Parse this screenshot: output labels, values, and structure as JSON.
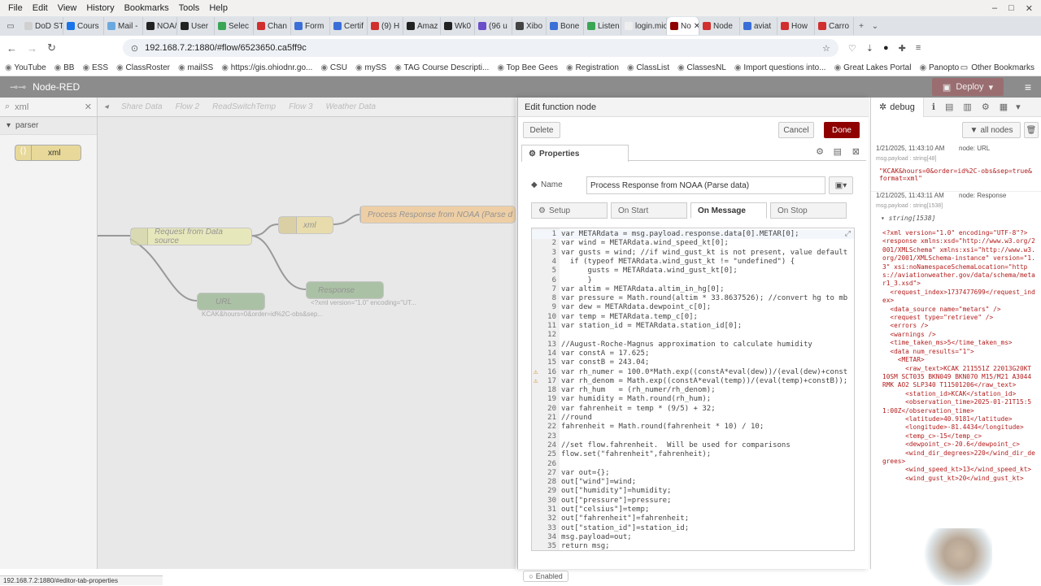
{
  "browser": {
    "menu": [
      "File",
      "Edit",
      "View",
      "History",
      "Bookmarks",
      "Tools",
      "Help"
    ],
    "tabs": [
      {
        "label": "DoD STE",
        "color": "#d0d0d0"
      },
      {
        "label": "Cours",
        "color": "#1a73e8"
      },
      {
        "label": "Mail -",
        "color": "#6aa9e0"
      },
      {
        "label": "NOA/",
        "color": "#222222"
      },
      {
        "label": "User",
        "color": "#222222"
      },
      {
        "label": "Selec",
        "color": "#3aa655"
      },
      {
        "label": "Chan",
        "color": "#d12e2e"
      },
      {
        "label": "Form",
        "color": "#3a6fd8"
      },
      {
        "label": "Certif",
        "color": "#3a6fd8"
      },
      {
        "label": "(9) H",
        "color": "#d12e2e"
      },
      {
        "label": "Amaz",
        "color": "#222222"
      },
      {
        "label": "Wk0",
        "color": "#222222"
      },
      {
        "label": "(96 u",
        "color": "#6b4fc9"
      },
      {
        "label": "Xibo",
        "color": "#444444"
      },
      {
        "label": "Bone",
        "color": "#3a6fd8"
      },
      {
        "label": "Listen",
        "color": "#3aa655"
      },
      {
        "label": "login.mic",
        "color": "#eeeeee"
      },
      {
        "label": "No",
        "color": "#8f0000"
      },
      {
        "label": "Node",
        "color": "#d12e2e"
      },
      {
        "label": "aviat",
        "color": "#3a6fd8"
      },
      {
        "label": "How",
        "color": "#d12e2e"
      },
      {
        "label": "Carro",
        "color": "#d12e2e"
      }
    ],
    "url": "192.168.7.2:1880/#flow/6523650.ca5ff9c",
    "bookmarks": [
      "YouTube",
      "BB",
      "ESS",
      "ClassRoster",
      "mailSS",
      "https://gis.ohiodnr.go...",
      "CSU",
      "mySS",
      "TAG Course Descripti...",
      "Top Bee Gees",
      "Registration",
      "ClassList",
      "ClassesNL",
      "Import questions into...",
      "Great Lakes Portal",
      "Panopto"
    ],
    "other_bookmarks": "Other Bookmarks",
    "status_url": "192.168.7.2:1880/#editor-tab-properties"
  },
  "nodered": {
    "title": "Node-RED",
    "deploy": "Deploy",
    "palette": {
      "search": "xml",
      "category": "parser",
      "node": "xml"
    },
    "workspace_tabs": [
      "Share Data",
      "Flow 2",
      "ReadSwitchTemp",
      "Flow 3",
      "Weather Data"
    ],
    "nodes": {
      "request": "Request from Data source",
      "xml": "xml",
      "process": "Process Response from NOAA (Parse d",
      "response": "Response",
      "response_status": "<?xml version=\"1.0\" encoding=\"UT...",
      "url": "URL",
      "url_status": "KCAK&hours=0&order=id%2C-obs&sep..."
    }
  },
  "editor": {
    "title": "Edit function node",
    "delete": "Delete",
    "cancel": "Cancel",
    "done": "Done",
    "properties": "Properties",
    "name_label": "Name",
    "name_value": "Process Response from NOAA (Parse data)",
    "tabs": [
      "Setup",
      "On Start",
      "On Message",
      "On Stop"
    ],
    "enabled": "Enabled",
    "code": [
      "var METARdata = msg.payload.response.data[0].METAR[0];",
      "var wind = METARdata.wind_speed_kt[0];",
      "var gusts = wind; //if wind_gust_kt is not present, value default",
      "  if (typeof METARdata.wind_gust_kt != \"undefined\") {",
      "      gusts = METARdata.wind_gust_kt[0];",
      "      }",
      "var altim = METARdata.altim_in_hg[0];",
      "var pressure = Math.round(altim * 33.8637526); //convert hg to mb",
      "var dew = METARdata.dewpoint_c[0];",
      "var temp = METARdata.temp_c[0];",
      "var station_id = METARdata.station_id[0];",
      "",
      "//August-Roche-Magnus approximation to calculate humidity",
      "var constA = 17.625;",
      "var constB = 243.04;",
      "var rh_numer = 100.0*Math.exp((constA*eval(dew))/(eval(dew)+const",
      "var rh_denom = Math.exp((constA*eval(temp))/(eval(temp)+constB));",
      "var rh_hum   = (rh_numer/rh_denom);",
      "var humidity = Math.round(rh_hum);",
      "var fahrenheit = temp * (9/5) + 32;",
      "//round",
      "fahrenheit = Math.round(fahrenheit * 10) / 10;",
      "",
      "//set flow.fahrenheit.  Will be used for comparisons",
      "flow.set(\"fahrenheit\",fahrenheit);",
      "",
      "var out={};",
      "out[\"wind\"]=wind;",
      "out[\"humidity\"]=humidity;",
      "out[\"pressure\"]=pressure;",
      "out[\"celsius\"]=temp;",
      "out[\"fahrenheit\"]=fahrenheit;",
      "out[\"station_id\"]=station_id;",
      "msg.payload=out;",
      "return msg;"
    ]
  },
  "debug": {
    "tab": "debug",
    "filter": "all nodes",
    "msg1_time": "1/21/2025, 11:43:10 AM",
    "msg1_node": "node: URL",
    "msg1_type": "msg.payload : string[48]",
    "msg1_value": "\"KCAK&hours=0&order=id%2C-obs&sep=true&format=xml\"",
    "msg2_time": "1/21/2025, 11:43:11 AM",
    "msg2_node": "node: Response",
    "msg2_type": "msg.payload : string[1538]",
    "msg2_summary": "string[1538]",
    "xml": "<?xml version=\"1.0\" encoding=\"UTF-8\"?>\n<response xmlns:xsd=\"http://www.w3.org/2001/XMLSchema\" xmlns:xsi=\"http://www.w3.org/2001/XMLSchema-instance\" version=\"1.3\" xsi:noNamespaceSchemaLocation=\"https://aviationweather.gov/data/schema/metar1_3.xsd\">\n  <request_index>1737477699</request_index>\n  <data_source name=\"metars\" />\n  <request type=\"retrieve\" />\n  <errors />\n  <warnings />\n  <time_taken_ms>5</time_taken_ms>\n  <data num_results=\"1\">\n    <METAR>\n      <raw_text>KCAK 211551Z 22013G20KT 10SM SCT035 BKN049 BKN070 M15/M21 A3044 RMK AO2 SLP340 T11501206</raw_text>\n      <station_id>KCAK</station_id>\n      <observation_time>2025-01-21T15:51:00Z</observation_time>\n      <latitude>40.9181</latitude>\n      <longitude>-81.4434</longitude>\n      <temp_c>-15</temp_c>\n      <dewpoint_c>-20.6</dewpoint_c>\n      <wind_dir_degrees>220</wind_dir_degrees>\n      <wind_speed_kt>13</wind_speed_kt>\n      <wind_gust_kt>20</wind_gust_kt>"
  }
}
